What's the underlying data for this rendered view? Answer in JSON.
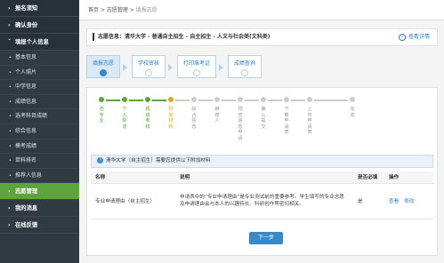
{
  "sidebar": {
    "top_items": [
      "报名须知",
      "确认身份",
      "填报个人信息"
    ],
    "sub_items": [
      "基本信息",
      "个人照片",
      "中学信息",
      "成绩信息",
      "选考科目成绩",
      "综合信息",
      "模考成绩",
      "单科排名",
      "推荐人信息"
    ],
    "bottom_items": [
      "志愿管理",
      "我的消息",
      "在线反馈"
    ]
  },
  "breadcrumb": {
    "home": "首页",
    "sep1": " > ",
    "mid": "志愿管理",
    "sep2": " > ",
    "current": "填报志愿"
  },
  "info": {
    "text": "志愿信息：清华大学 - 普通自主招生 - 自主招生 - 人文与社会类(文科类)",
    "detail": "查看详情",
    "detail_icon": "i"
  },
  "tabs": [
    "填报志愿",
    "学校审核",
    "打印准考证",
    "成绩查询"
  ],
  "steps": [
    "选专业",
    "个人陈述",
    "成绩考核",
    "附加材料",
    "综合信息",
    "推荐人",
    "预览信息申请",
    "确认提交",
    "下载申请表",
    "上传申请表",
    "完成"
  ],
  "notice": {
    "text": "清华大学（自主招生）需要您提供以下附加材料",
    "icon": "i"
  },
  "table": {
    "headers": [
      "名称",
      "说明",
      "是否必填",
      "操作"
    ],
    "rows": [
      {
        "name": "专业申请理由（自主招生）",
        "desc": "申请表中的“专业申请理由”是专业测试前的重要参考。学生填写的专业志愿及申请理由会与本人的兴趣特长、科研创作等密切相关。",
        "required": "是",
        "view": "查看",
        "edit": "修改"
      }
    ]
  },
  "next_button": "下一步"
}
